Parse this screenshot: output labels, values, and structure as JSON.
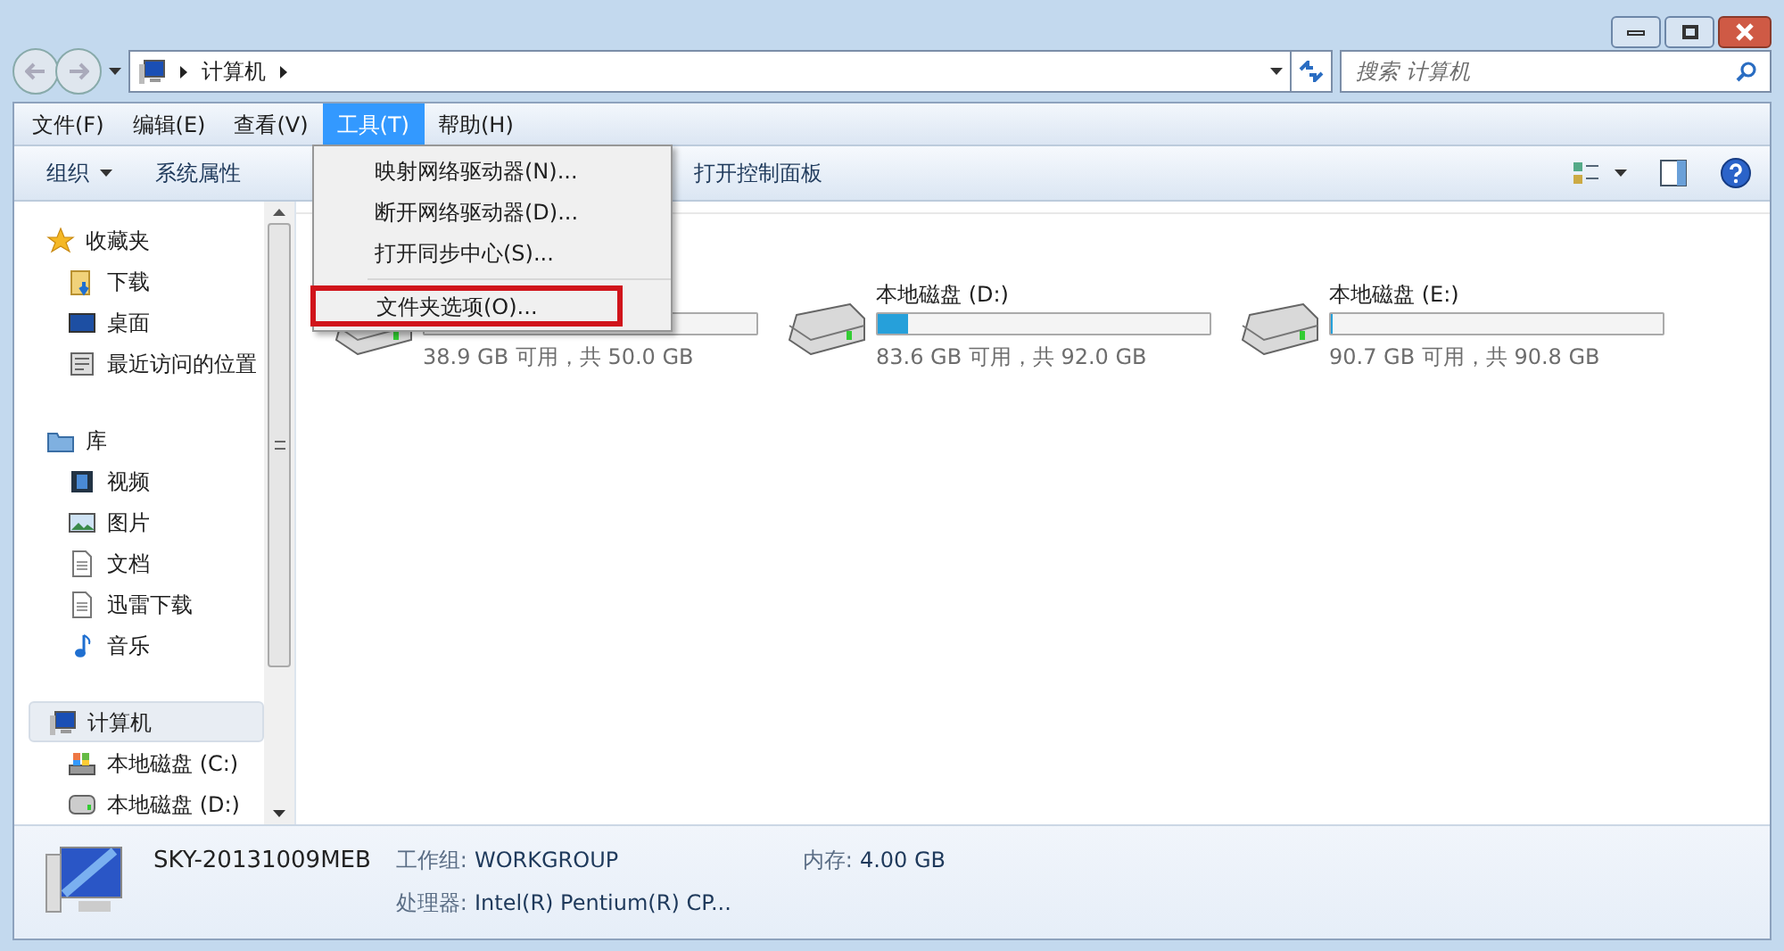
{
  "address_bar": {
    "path": [
      "计算机"
    ],
    "search_placeholder": "搜索 计算机"
  },
  "menu_bar": [
    {
      "label": "文件(F)",
      "selected": false
    },
    {
      "label": "编辑(E)",
      "selected": false
    },
    {
      "label": "查看(V)",
      "selected": false
    },
    {
      "label": "工具(T)",
      "selected": true
    },
    {
      "label": "帮助(H)",
      "selected": false
    }
  ],
  "toolbar": {
    "left": [
      {
        "label": "组织",
        "dropdown": true
      },
      {
        "label": "系统属性",
        "dropdown": false
      }
    ],
    "right": [
      {
        "label": "打开控制面板",
        "dropdown": false
      }
    ]
  },
  "tools_menu": [
    {
      "label": "映射网络驱动器(N)...",
      "highlighted": false
    },
    {
      "label": "断开网络驱动器(D)...",
      "highlighted": false
    },
    {
      "label": "打开同步中心(S)...",
      "highlighted": false
    },
    {
      "label": "文件夹选项(O)...",
      "highlighted": true
    }
  ],
  "sidebar": [
    {
      "label": "收藏夹",
      "kind": "star",
      "selected": false,
      "children": [
        {
          "label": "下载",
          "kind": "download"
        },
        {
          "label": "桌面",
          "kind": "desktop"
        },
        {
          "label": "最近访问的位置",
          "kind": "recent"
        }
      ]
    },
    {
      "label": "库",
      "kind": "library",
      "selected": false,
      "children": [
        {
          "label": "视频",
          "kind": "video"
        },
        {
          "label": "图片",
          "kind": "picture"
        },
        {
          "label": "文档",
          "kind": "document"
        },
        {
          "label": "迅雷下载",
          "kind": "document"
        },
        {
          "label": "音乐",
          "kind": "music"
        }
      ]
    },
    {
      "label": "计算机",
      "kind": "computer",
      "selected": true,
      "children": [
        {
          "label": "本地磁盘 (C:)",
          "kind": "system-drive"
        },
        {
          "label": "本地磁盘 (D:)",
          "kind": "drive"
        }
      ]
    }
  ],
  "drives": [
    {
      "free": "38.9 GB 可用，共 50.0 GB"
    },
    {
      "name": "本地磁盘 (D:)",
      "level": 0.09,
      "free": "83.6 GB 可用，共 92.0 GB"
    },
    {
      "name": "本地磁盘 (E:)",
      "level": 0.005,
      "free": "90.7 GB 可用，共 90.8 GB"
    }
  ],
  "details": {
    "computer_name": "SKY-20131009MEB",
    "fields": [
      {
        "label": "工作组:",
        "value": "WORKGROUP"
      },
      {
        "label": "内存:",
        "value": "4.00 GB"
      },
      {
        "label": "处理器:",
        "value": "Intel(R) Pentium(R) CP..."
      }
    ]
  }
}
